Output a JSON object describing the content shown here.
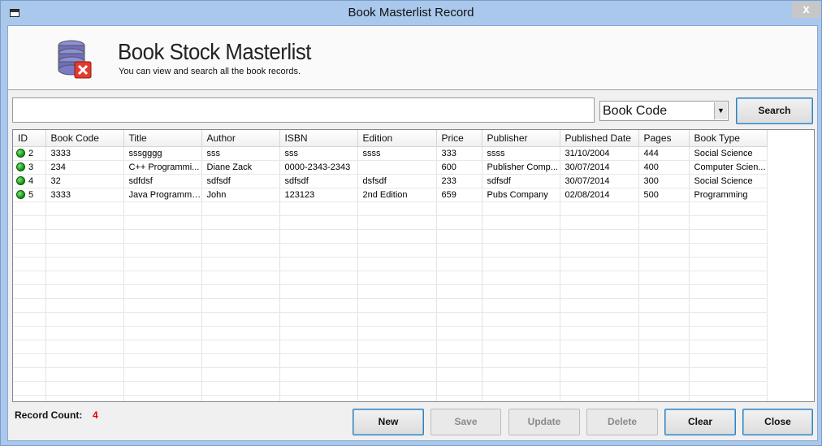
{
  "window": {
    "title": "Book Masterlist Record",
    "close_glyph": "x"
  },
  "header": {
    "title": "Book Stock Masterlist",
    "subtitle": "You can view and search all the book records.",
    "icon": "database-delete-icon"
  },
  "search": {
    "value": "",
    "placeholder": "",
    "button_label": "Search"
  },
  "filter": {
    "selected": "Book Code"
  },
  "table": {
    "columns": [
      "ID",
      "Book Code",
      "Title",
      "Author",
      "ISBN",
      "Edition",
      "Price",
      "Publisher",
      "Published Date",
      "Pages",
      "Book Type"
    ],
    "rows": [
      [
        "2",
        "3333",
        "sssgggg",
        "sss",
        "sss",
        "ssss",
        "333",
        "ssss",
        "31/10/2004",
        "444",
        "Social Science"
      ],
      [
        "3",
        "234",
        "C++ Programmi...",
        "Diane Zack",
        "0000-2343-2343",
        "",
        "600",
        "Publisher Comp...",
        "30/07/2014",
        "400",
        "Computer Scien..."
      ],
      [
        "4",
        "32",
        "sdfdsf",
        "sdfsdf",
        "sdfsdf",
        "dsfsdf",
        "233",
        "sdfsdf",
        "30/07/2014",
        "300",
        "Social Science"
      ],
      [
        "5",
        "3333",
        "Java Programmi...",
        "John",
        "123123",
        "2nd Edition",
        "659",
        "Pubs Company",
        "02/08/2014",
        "500",
        "Programming"
      ]
    ],
    "row_status_color": "#1a9a1a"
  },
  "footer": {
    "record_count_label": "Record Count:",
    "record_count": "4",
    "buttons": {
      "new": "New",
      "save": "Save",
      "update": "Update",
      "delete": "Delete",
      "clear": "Clear",
      "close": "Close"
    }
  }
}
